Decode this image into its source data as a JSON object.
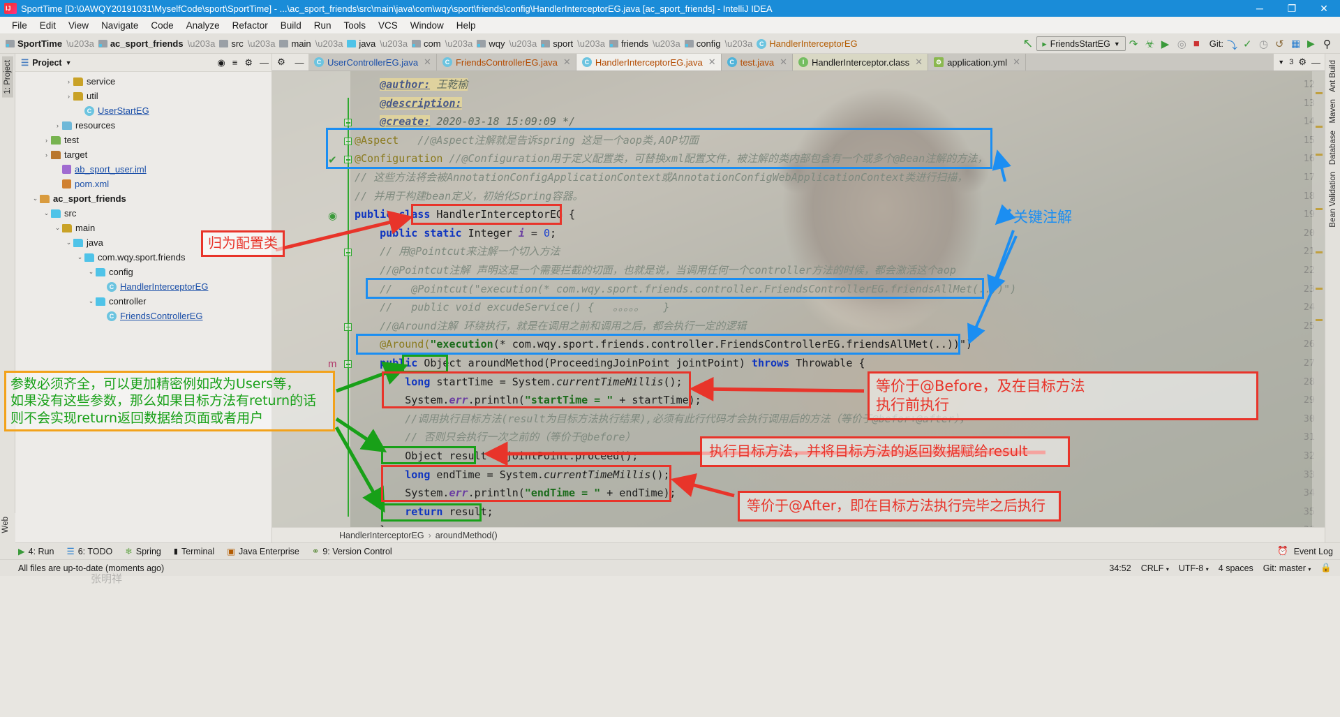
{
  "window": {
    "title": "SportTime [D:\\0AWQY20191031\\MyselfCode\\sport\\SportTime] - ...\\ac_sport_friends\\src\\main\\java\\com\\wqy\\sport\\friends\\config\\HandlerInterceptorEG.java [ac_sport_friends] - IntelliJ IDEA",
    "minimize": "─",
    "maximize": "❐",
    "close": "✕"
  },
  "menu": [
    "File",
    "Edit",
    "View",
    "Navigate",
    "Code",
    "Analyze",
    "Refactor",
    "Build",
    "Run",
    "Tools",
    "VCS",
    "Window",
    "Help"
  ],
  "navbar": {
    "crumbs": [
      {
        "label": "SportTime",
        "type": "project"
      },
      {
        "label": "ac_sport_friends",
        "type": "module"
      },
      {
        "label": "src",
        "type": "src"
      },
      {
        "label": "main",
        "type": "folder"
      },
      {
        "label": "java",
        "type": "java"
      },
      {
        "label": "com",
        "type": "pkg"
      },
      {
        "label": "wqy",
        "type": "pkg"
      },
      {
        "label": "sport",
        "type": "pkg"
      },
      {
        "label": "friends",
        "type": "pkg"
      },
      {
        "label": "config",
        "type": "pkg"
      },
      {
        "label": "HandlerInterceptorEG",
        "type": "class"
      }
    ],
    "run_config": "FriendsStartEG",
    "git_label": "Git:"
  },
  "project_panel": {
    "title": "Project",
    "tree": [
      {
        "depth": 4,
        "arrow": "›",
        "icon": "folder",
        "label": "service"
      },
      {
        "depth": 4,
        "arrow": "›",
        "icon": "folder",
        "label": "util"
      },
      {
        "depth": 5,
        "arrow": "",
        "icon": "class",
        "label": "UserStartEG",
        "style": "blue-underline"
      },
      {
        "depth": 3,
        "arrow": "›",
        "icon": "resources",
        "label": "resources"
      },
      {
        "depth": 2,
        "arrow": "›",
        "icon": "test",
        "label": "test"
      },
      {
        "depth": 2,
        "arrow": "›",
        "icon": "target",
        "label": "target"
      },
      {
        "depth": 3,
        "arrow": "",
        "icon": "iml",
        "label": "ab_sport_user.iml",
        "style": "blue-underline"
      },
      {
        "depth": 3,
        "arrow": "",
        "icon": "xml",
        "label": "pom.xml",
        "style": "blue"
      },
      {
        "depth": 1,
        "arrow": "⌄",
        "icon": "module",
        "label": "ac_sport_friends",
        "style": "bold"
      },
      {
        "depth": 2,
        "arrow": "⌄",
        "icon": "src",
        "label": "src"
      },
      {
        "depth": 3,
        "arrow": "⌄",
        "icon": "folder",
        "label": "main"
      },
      {
        "depth": 4,
        "arrow": "⌄",
        "icon": "java",
        "label": "java"
      },
      {
        "depth": 5,
        "arrow": "⌄",
        "icon": "pkg",
        "label": "com.wqy.sport.friends"
      },
      {
        "depth": 6,
        "arrow": "⌄",
        "icon": "pkg",
        "label": "config"
      },
      {
        "depth": 7,
        "arrow": "",
        "icon": "class",
        "label": "HandlerInterceptorEG",
        "style": "blue-underline"
      },
      {
        "depth": 6,
        "arrow": "⌄",
        "icon": "pkg",
        "label": "controller"
      },
      {
        "depth": 7,
        "arrow": "",
        "icon": "class",
        "label": "FriendsControllerEG",
        "style": "blue-underline"
      }
    ]
  },
  "editor_tabs": [
    {
      "label": "UserControllerEG.java",
      "icon": "class",
      "state": "inactive",
      "color": "blue"
    },
    {
      "label": "FriendsControllerEG.java",
      "icon": "class",
      "state": "inactive",
      "color": "orange"
    },
    {
      "label": "HandlerInterceptorEG.java",
      "icon": "class",
      "state": "active",
      "color": "orange"
    },
    {
      "label": "test.java",
      "icon": "class-run",
      "state": "inactive",
      "color": "orange"
    },
    {
      "label": "HandlerInterceptor.class",
      "icon": "interface",
      "state": "class",
      "color": "dark"
    },
    {
      "label": "application.yml",
      "icon": "yml",
      "state": "inactive",
      "color": "dark"
    }
  ],
  "tab_extra_count": "3",
  "code": {
    "first_line_no": 12,
    "lines": [
      {
        "no": 12,
        "segs": [
          {
            "t": "    ",
            "c": "plain"
          },
          {
            "t": "@author:",
            "c": "jdtag hl"
          },
          {
            "t": " 王乾榆",
            "c": "cmtjd hl"
          }
        ]
      },
      {
        "no": 13,
        "segs": [
          {
            "t": "    ",
            "c": "plain"
          },
          {
            "t": "@description:",
            "c": "jdtag hl"
          }
        ]
      },
      {
        "no": 14,
        "segs": [
          {
            "t": "    ",
            "c": "plain"
          },
          {
            "t": "@create:",
            "c": "jdtag hl"
          },
          {
            "t": " 2020-03-18 15:09:09 */",
            "c": "cmtjd"
          }
        ]
      },
      {
        "no": 15,
        "segs": [
          {
            "t": "@Aspect",
            "c": "ann"
          },
          {
            "t": "   //@Aspect注解就是告诉spring 这是一个aop类,AOP切面",
            "c": "cmt"
          }
        ]
      },
      {
        "no": 16,
        "segs": [
          {
            "t": "@Configuration",
            "c": "ann"
          },
          {
            "t": " //@Configuration用于定义配置类，可替换xml配置文件，被注解的类内部包含有一个或多个@Bean注解的方法，",
            "c": "cmt"
          }
        ]
      },
      {
        "no": 17,
        "segs": [
          {
            "t": "// 这些方法将会被AnnotationConfigApplicationContext或AnnotationConfigWebApplicationContext类进行扫描，",
            "c": "cmt"
          }
        ]
      },
      {
        "no": 18,
        "segs": [
          {
            "t": "// 并用于构建bean定义，初始化Spring容器。",
            "c": "cmt"
          }
        ]
      },
      {
        "no": 19,
        "segs": [
          {
            "t": "public class ",
            "c": "kw"
          },
          {
            "t": "HandlerInterceptorEG {",
            "c": "plain"
          }
        ]
      },
      {
        "no": 20,
        "segs": [
          {
            "t": "    ",
            "c": "plain"
          },
          {
            "t": "public static ",
            "c": "kw"
          },
          {
            "t": "Integer ",
            "c": "plain"
          },
          {
            "t": "i",
            "c": "fld"
          },
          {
            "t": " = ",
            "c": "plain"
          },
          {
            "t": "0",
            "c": "num"
          },
          {
            "t": ";",
            "c": "plain"
          }
        ]
      },
      {
        "no": 21,
        "segs": [
          {
            "t": "    // 用@Pointcut来注解一个切入方法",
            "c": "cmt"
          }
        ]
      },
      {
        "no": 22,
        "segs": [
          {
            "t": "    //@Pointcut注解 声明这是一个需要拦截的切面，也就是说，当调用任何一个controller方法的时候，都会激活这个aop",
            "c": "cmt"
          }
        ]
      },
      {
        "no": 23,
        "segs": [
          {
            "t": "    //   @Pointcut(\"execution(* com.wqy.sport.friends.controller.FriendsControllerEG.friendsAllMet(..))\")",
            "c": "cmt"
          }
        ]
      },
      {
        "no": 24,
        "segs": [
          {
            "t": "    //   public void excudeService() {   。。。。。   }",
            "c": "cmt"
          }
        ]
      },
      {
        "no": 25,
        "segs": [
          {
            "t": "    //@Around注解 环绕执行，就是在调用之前和调用之后，都会执行一定的逻辑",
            "c": "cmt"
          }
        ]
      },
      {
        "no": 26,
        "segs": [
          {
            "t": "    ",
            "c": "plain"
          },
          {
            "t": "@Around(",
            "c": "ann"
          },
          {
            "t": "\"execution",
            "c": "str"
          },
          {
            "t": "(* com.wqy.sport.friends.controller.FriendsControllerEG.friendsAllMet(..))\")",
            "c": "plain"
          }
        ]
      },
      {
        "no": 27,
        "segs": [
          {
            "t": "    ",
            "c": "plain"
          },
          {
            "t": "public ",
            "c": "kw"
          },
          {
            "t": "Object ",
            "c": "plain"
          },
          {
            "t": "aroundMethod(ProceedingJoinPoint jointPoint) ",
            "c": "plain"
          },
          {
            "t": "throws ",
            "c": "kw"
          },
          {
            "t": "Throwable {",
            "c": "plain"
          }
        ]
      },
      {
        "no": 28,
        "segs": [
          {
            "t": "        ",
            "c": "plain"
          },
          {
            "t": "long ",
            "c": "kw"
          },
          {
            "t": "startTime = System.",
            "c": "plain"
          },
          {
            "t": "currentTimeMillis",
            "c": "ital"
          },
          {
            "t": "();",
            "c": "plain"
          }
        ]
      },
      {
        "no": 29,
        "segs": [
          {
            "t": "        System.",
            "c": "plain"
          },
          {
            "t": "err",
            "c": "fld"
          },
          {
            "t": ".println(",
            "c": "plain"
          },
          {
            "t": "\"startTime = \"",
            "c": "str"
          },
          {
            "t": " + startTime);",
            "c": "plain"
          }
        ]
      },
      {
        "no": 30,
        "segs": [
          {
            "t": "        //调用执行目标方法(result为目标方法执行结果),必须有此行代码才会执行调用后的方法（等价于@befor+@after），",
            "c": "cmt"
          }
        ]
      },
      {
        "no": 31,
        "segs": [
          {
            "t": "        // 否则只会执行一次之前的（等价于@before）",
            "c": "cmt"
          }
        ]
      },
      {
        "no": 32,
        "segs": [
          {
            "t": "        Object result = jointPoint.proceed();",
            "c": "plain"
          }
        ]
      },
      {
        "no": 33,
        "segs": [
          {
            "t": "        ",
            "c": "plain"
          },
          {
            "t": "long ",
            "c": "kw"
          },
          {
            "t": "endTime = System.",
            "c": "plain"
          },
          {
            "t": "currentTimeMillis",
            "c": "ital"
          },
          {
            "t": "();",
            "c": "plain"
          }
        ]
      },
      {
        "no": 34,
        "segs": [
          {
            "t": "        System.",
            "c": "plain"
          },
          {
            "t": "err",
            "c": "fld"
          },
          {
            "t": ".println(",
            "c": "plain"
          },
          {
            "t": "\"endTime = \"",
            "c": "str"
          },
          {
            "t": " + endTime);",
            "c": "plain"
          }
        ]
      },
      {
        "no": 35,
        "segs": [
          {
            "t": "        ",
            "c": "plain"
          },
          {
            "t": "return ",
            "c": "kw"
          },
          {
            "t": "result;",
            "c": "plain"
          }
        ]
      },
      {
        "no": 36,
        "segs": [
          {
            "t": "    }",
            "c": "plain"
          }
        ]
      }
    ]
  },
  "annotations": [
    {
      "id": "key-annotation",
      "text": "关键注解",
      "color": "#1b8ef2"
    },
    {
      "id": "config-class",
      "text": "归为配置类",
      "color": "#e8342a"
    },
    {
      "id": "param-note",
      "text": "参数必须齐全，可以更加精密例如改为Users等，\n如果没有这些参数，那么如果目标方法有return的话\n则不会实现return返回数据给页面或者用户",
      "color": "#18a018",
      "border": "#f2a21b"
    },
    {
      "id": "before-equiv",
      "text": "等价于@Before，及在目标方法\n执行前执行",
      "color": "#e8342a"
    },
    {
      "id": "proceed-note",
      "text": "执行目标方法，并将目标方法的返回数据赋给result",
      "color": "#e8342a"
    },
    {
      "id": "after-equiv",
      "text": "等价于@After，即在目标方法执行完毕之后执行",
      "color": "#e8342a"
    }
  ],
  "editor_breadcrumb": [
    "HandlerInterceptorEG",
    "aroundMethod()"
  ],
  "toolwindow_bar": [
    {
      "label": "4: Run",
      "icon": "run-icon"
    },
    {
      "label": "6: TODO",
      "icon": "todo-icon"
    },
    {
      "label": "Spring",
      "icon": "spring-icon"
    },
    {
      "label": "Terminal",
      "icon": "terminal-icon"
    },
    {
      "label": "Java Enterprise",
      "icon": "java-icon"
    },
    {
      "label": "9: Version Control",
      "icon": "vcs-icon"
    }
  ],
  "toolwindow_right": [
    {
      "label": "Event Log",
      "icon": "event-log-icon"
    }
  ],
  "status_bar": {
    "message": "All files are up-to-date (moments ago)",
    "caret": "34:52",
    "line_sep": "CRLF",
    "encoding": "UTF-8",
    "indent": "4 spaces",
    "branch": "Git: master"
  },
  "left_rail_tabs": [
    "1: Project"
  ],
  "right_rail_tabs": [
    "Ant Build",
    "Maven",
    "Database",
    "Bean Validation"
  ],
  "bottom_left_rail": [
    "Web"
  ],
  "colors": {
    "titlebar": "#1a8cd8",
    "accent_blue": "#1b8ef2",
    "accent_red": "#e8342a",
    "accent_green": "#18a018",
    "accent_orange": "#f2a21b"
  }
}
